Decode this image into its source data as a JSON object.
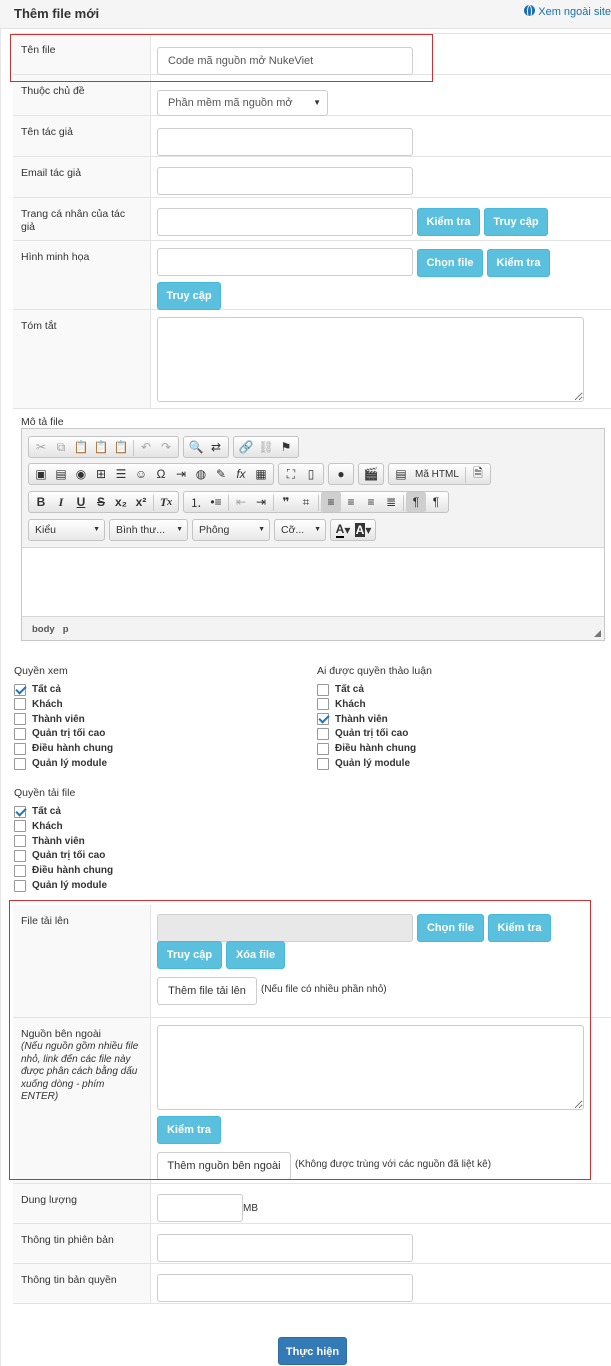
{
  "header": {
    "title": "Thêm file mới",
    "external_link": "Xem ngoài site"
  },
  "fields": {
    "file_name": {
      "label": "Tên file",
      "value": "Code mã nguồn mở NukeViet"
    },
    "category": {
      "label": "Thuộc chủ đề",
      "selected": "Phần mềm mã nguồn mở"
    },
    "author_name": {
      "label": "Tên tác giả",
      "value": ""
    },
    "author_email": {
      "label": "Email tác giả",
      "value": ""
    },
    "author_url": {
      "label": "Trang cá nhân của tác giả",
      "value": "",
      "check_label": "Kiểm tra",
      "visit_label": "Truy cập"
    },
    "image": {
      "label": "Hình minh họa",
      "value": "",
      "choose_label": "Chọn file",
      "check_label": "Kiểm tra",
      "visit_label": "Truy cập"
    },
    "summary": {
      "label": "Tóm tắt",
      "value": ""
    },
    "description": {
      "label": "Mô tả file"
    }
  },
  "editor": {
    "combos": [
      "Kiểu",
      "Bình thư...",
      "Phông",
      "Cỡ..."
    ],
    "source_label": "Mã HTML",
    "path": [
      "body",
      "p"
    ]
  },
  "permissions": {
    "view": {
      "title": "Quyền xem",
      "options": [
        {
          "label": "Tất cả",
          "checked": true
        },
        {
          "label": "Khách",
          "checked": false
        },
        {
          "label": "Thành viên",
          "checked": false
        },
        {
          "label": "Quản trị tối cao",
          "checked": false
        },
        {
          "label": "Điều hành chung",
          "checked": false
        },
        {
          "label": "Quản lý module",
          "checked": false
        }
      ]
    },
    "discuss": {
      "title": "Ai được quyền thảo luận",
      "options": [
        {
          "label": "Tất cả",
          "checked": false
        },
        {
          "label": "Khách",
          "checked": false
        },
        {
          "label": "Thành viên",
          "checked": true
        },
        {
          "label": "Quản trị tối cao",
          "checked": false
        },
        {
          "label": "Điều hành chung",
          "checked": false
        },
        {
          "label": "Quản lý module",
          "checked": false
        }
      ]
    },
    "download": {
      "title": "Quyền tải file",
      "options": [
        {
          "label": "Tất cả",
          "checked": true
        },
        {
          "label": "Khách",
          "checked": false
        },
        {
          "label": "Thành viên",
          "checked": false
        },
        {
          "label": "Quản trị tối cao",
          "checked": false
        },
        {
          "label": "Điều hành chung",
          "checked": false
        },
        {
          "label": "Quản lý module",
          "checked": false
        }
      ]
    }
  },
  "upload": {
    "label": "File tải lên",
    "value": "",
    "choose_label": "Chọn file",
    "check_label": "Kiểm tra",
    "visit_label": "Truy cập",
    "delete_label": "Xóa file",
    "add_label": "Thêm file tải lên",
    "add_note": "(Nếu file có nhiều phần nhỏ)"
  },
  "external": {
    "label": "Nguồn bên ngoài",
    "hint": "(Nếu nguồn gồm nhiều file nhỏ, link đến các file này được phân cách bằng dấu xuống dòng - phím ENTER)",
    "value": "",
    "check_label": "Kiểm tra",
    "add_label": "Thêm nguồn bên ngoài",
    "add_note": "(Không được trùng với các nguồn đã liệt kê)"
  },
  "filesize": {
    "label": "Dung lượng",
    "value": "",
    "unit": "MB"
  },
  "version": {
    "label": "Thông tin phiên bản",
    "value": ""
  },
  "copyright": {
    "label": "Thông tin bản quyền",
    "value": ""
  },
  "submit_label": "Thực hiện",
  "colors": {
    "info": "#5bc0de",
    "primary": "#337ab7",
    "highlight": "#d32f2f",
    "link": "#1a6fb4"
  }
}
